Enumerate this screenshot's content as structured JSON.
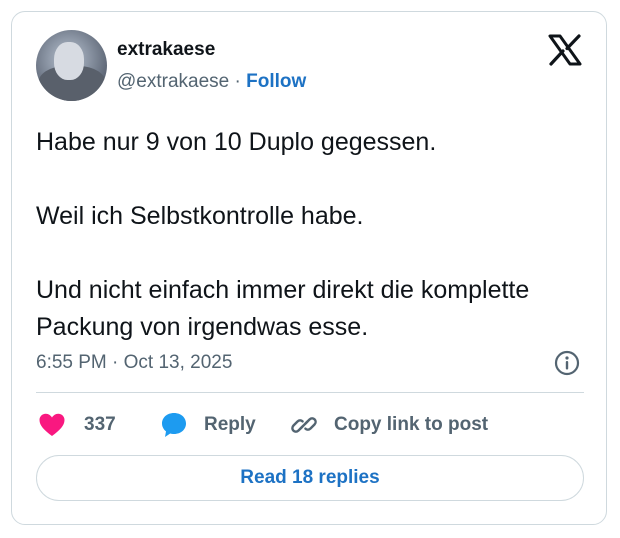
{
  "author": {
    "name": "extrakaese",
    "handle": "@extrakaese",
    "separator": "·",
    "follow_label": "Follow"
  },
  "tweet": {
    "lines": [
      "Habe nur 9 von 10 Duplo gegessen.",
      "Weil ich Selbstkontrolle habe.",
      "Und nicht einfach immer direkt die komplette Packung von irgendwas esse."
    ],
    "timestamp": "6:55 PM · Oct 13, 2025"
  },
  "actions": {
    "like_count": "337",
    "reply_label": "Reply",
    "copy_label": "Copy link to post"
  },
  "footer": {
    "read_replies_label": "Read 18 replies"
  },
  "icons": {
    "logo": "x-logo-icon",
    "info": "info-icon",
    "like": "heart-icon",
    "reply": "speech-bubble-icon",
    "copy": "link-icon"
  },
  "colors": {
    "like": "#f91880",
    "reply": "#1d9bf0",
    "link_blue": "#1d72c4",
    "muted": "#536471",
    "border": "#cfd9de"
  }
}
